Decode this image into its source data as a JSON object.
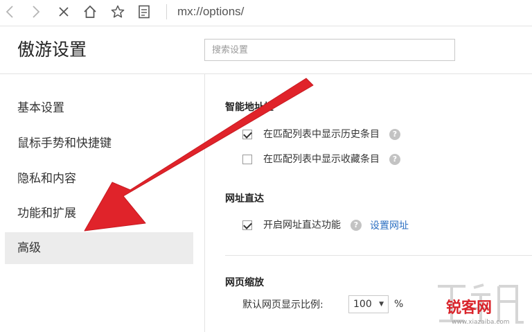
{
  "toolbar": {
    "icons": [
      "back-icon",
      "forward-icon",
      "close-icon",
      "home-icon",
      "star-icon",
      "notes-icon"
    ],
    "address": "mx://options/"
  },
  "header": {
    "title": "傲游设置",
    "search_placeholder": "搜索设置"
  },
  "sidebar": {
    "items": [
      {
        "label": "基本设置"
      },
      {
        "label": "鼠标手势和快捷键"
      },
      {
        "label": "隐私和内容"
      },
      {
        "label": "功能和扩展"
      },
      {
        "label": "高级"
      }
    ],
    "active_index": 4
  },
  "content": {
    "smart_address": {
      "title": "智能地址栏",
      "options": [
        {
          "label": "在匹配列表中显示历史条目",
          "checked": true
        },
        {
          "label": "在匹配列表中显示收藏条目",
          "checked": false
        }
      ]
    },
    "url_direct": {
      "title": "网址直达",
      "option": {
        "label": "开启网址直达功能",
        "checked": true
      },
      "link": "设置网址"
    },
    "zoom": {
      "title": "网页缩放",
      "label": "默认网页显示比例:",
      "value": "100",
      "unit": "%"
    }
  },
  "watermark": {
    "text_cn": "锐客网",
    "text_url": "www.xiazaiba.com"
  },
  "colors": {
    "arrow": "#e0232a",
    "link": "#2b6fc2",
    "active_bg": "#ececec"
  }
}
